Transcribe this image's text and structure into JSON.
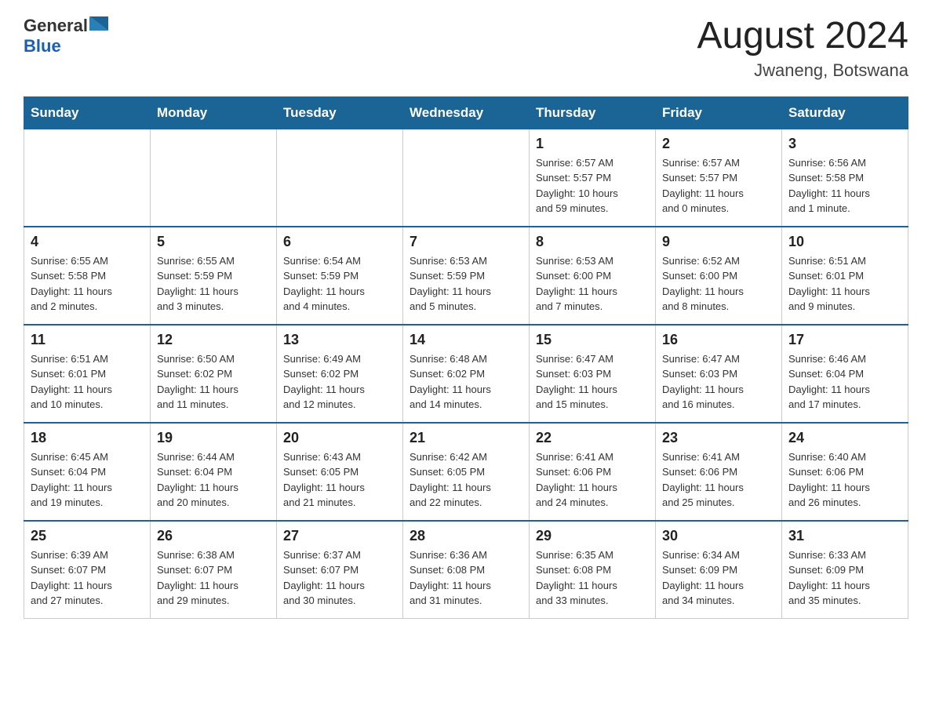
{
  "header": {
    "logo_general": "General",
    "logo_blue": "Blue",
    "month_title": "August 2024",
    "location": "Jwaneng, Botswana"
  },
  "days_of_week": [
    "Sunday",
    "Monday",
    "Tuesday",
    "Wednesday",
    "Thursday",
    "Friday",
    "Saturday"
  ],
  "weeks": [
    [
      {
        "day": "",
        "info": ""
      },
      {
        "day": "",
        "info": ""
      },
      {
        "day": "",
        "info": ""
      },
      {
        "day": "",
        "info": ""
      },
      {
        "day": "1",
        "info": "Sunrise: 6:57 AM\nSunset: 5:57 PM\nDaylight: 10 hours\nand 59 minutes."
      },
      {
        "day": "2",
        "info": "Sunrise: 6:57 AM\nSunset: 5:57 PM\nDaylight: 11 hours\nand 0 minutes."
      },
      {
        "day": "3",
        "info": "Sunrise: 6:56 AM\nSunset: 5:58 PM\nDaylight: 11 hours\nand 1 minute."
      }
    ],
    [
      {
        "day": "4",
        "info": "Sunrise: 6:55 AM\nSunset: 5:58 PM\nDaylight: 11 hours\nand 2 minutes."
      },
      {
        "day": "5",
        "info": "Sunrise: 6:55 AM\nSunset: 5:59 PM\nDaylight: 11 hours\nand 3 minutes."
      },
      {
        "day": "6",
        "info": "Sunrise: 6:54 AM\nSunset: 5:59 PM\nDaylight: 11 hours\nand 4 minutes."
      },
      {
        "day": "7",
        "info": "Sunrise: 6:53 AM\nSunset: 5:59 PM\nDaylight: 11 hours\nand 5 minutes."
      },
      {
        "day": "8",
        "info": "Sunrise: 6:53 AM\nSunset: 6:00 PM\nDaylight: 11 hours\nand 7 minutes."
      },
      {
        "day": "9",
        "info": "Sunrise: 6:52 AM\nSunset: 6:00 PM\nDaylight: 11 hours\nand 8 minutes."
      },
      {
        "day": "10",
        "info": "Sunrise: 6:51 AM\nSunset: 6:01 PM\nDaylight: 11 hours\nand 9 minutes."
      }
    ],
    [
      {
        "day": "11",
        "info": "Sunrise: 6:51 AM\nSunset: 6:01 PM\nDaylight: 11 hours\nand 10 minutes."
      },
      {
        "day": "12",
        "info": "Sunrise: 6:50 AM\nSunset: 6:02 PM\nDaylight: 11 hours\nand 11 minutes."
      },
      {
        "day": "13",
        "info": "Sunrise: 6:49 AM\nSunset: 6:02 PM\nDaylight: 11 hours\nand 12 minutes."
      },
      {
        "day": "14",
        "info": "Sunrise: 6:48 AM\nSunset: 6:02 PM\nDaylight: 11 hours\nand 14 minutes."
      },
      {
        "day": "15",
        "info": "Sunrise: 6:47 AM\nSunset: 6:03 PM\nDaylight: 11 hours\nand 15 minutes."
      },
      {
        "day": "16",
        "info": "Sunrise: 6:47 AM\nSunset: 6:03 PM\nDaylight: 11 hours\nand 16 minutes."
      },
      {
        "day": "17",
        "info": "Sunrise: 6:46 AM\nSunset: 6:04 PM\nDaylight: 11 hours\nand 17 minutes."
      }
    ],
    [
      {
        "day": "18",
        "info": "Sunrise: 6:45 AM\nSunset: 6:04 PM\nDaylight: 11 hours\nand 19 minutes."
      },
      {
        "day": "19",
        "info": "Sunrise: 6:44 AM\nSunset: 6:04 PM\nDaylight: 11 hours\nand 20 minutes."
      },
      {
        "day": "20",
        "info": "Sunrise: 6:43 AM\nSunset: 6:05 PM\nDaylight: 11 hours\nand 21 minutes."
      },
      {
        "day": "21",
        "info": "Sunrise: 6:42 AM\nSunset: 6:05 PM\nDaylight: 11 hours\nand 22 minutes."
      },
      {
        "day": "22",
        "info": "Sunrise: 6:41 AM\nSunset: 6:06 PM\nDaylight: 11 hours\nand 24 minutes."
      },
      {
        "day": "23",
        "info": "Sunrise: 6:41 AM\nSunset: 6:06 PM\nDaylight: 11 hours\nand 25 minutes."
      },
      {
        "day": "24",
        "info": "Sunrise: 6:40 AM\nSunset: 6:06 PM\nDaylight: 11 hours\nand 26 minutes."
      }
    ],
    [
      {
        "day": "25",
        "info": "Sunrise: 6:39 AM\nSunset: 6:07 PM\nDaylight: 11 hours\nand 27 minutes."
      },
      {
        "day": "26",
        "info": "Sunrise: 6:38 AM\nSunset: 6:07 PM\nDaylight: 11 hours\nand 29 minutes."
      },
      {
        "day": "27",
        "info": "Sunrise: 6:37 AM\nSunset: 6:07 PM\nDaylight: 11 hours\nand 30 minutes."
      },
      {
        "day": "28",
        "info": "Sunrise: 6:36 AM\nSunset: 6:08 PM\nDaylight: 11 hours\nand 31 minutes."
      },
      {
        "day": "29",
        "info": "Sunrise: 6:35 AM\nSunset: 6:08 PM\nDaylight: 11 hours\nand 33 minutes."
      },
      {
        "day": "30",
        "info": "Sunrise: 6:34 AM\nSunset: 6:09 PM\nDaylight: 11 hours\nand 34 minutes."
      },
      {
        "day": "31",
        "info": "Sunrise: 6:33 AM\nSunset: 6:09 PM\nDaylight: 11 hours\nand 35 minutes."
      }
    ]
  ]
}
